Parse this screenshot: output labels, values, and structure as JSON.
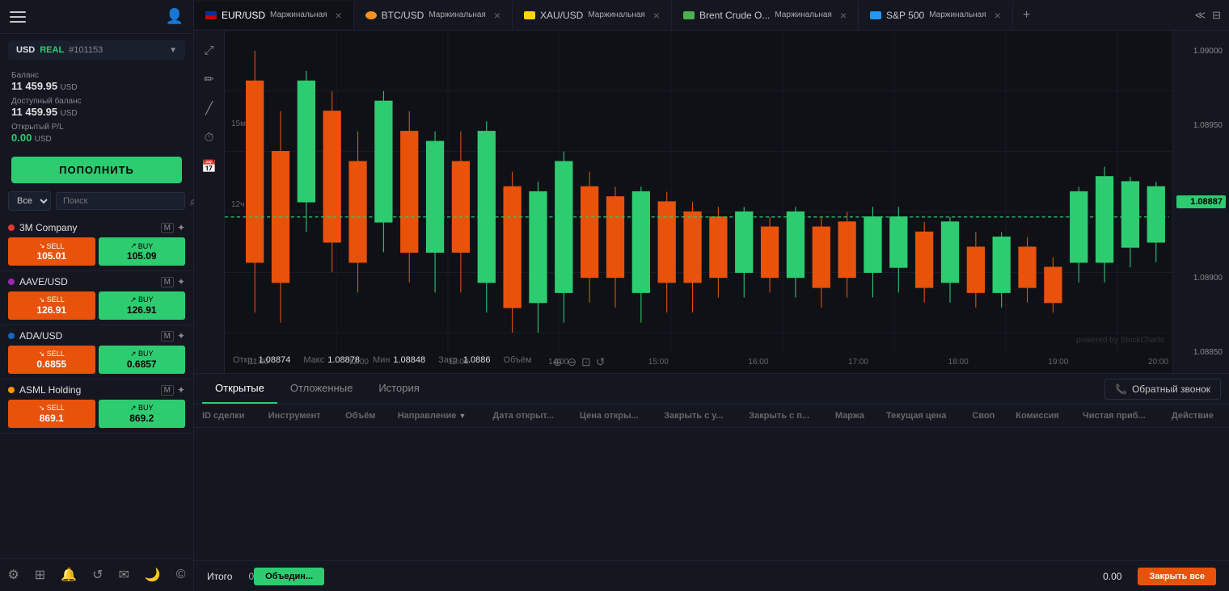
{
  "sidebar": {
    "account": {
      "currency": "USD",
      "type": "REAL",
      "id": "#101153"
    },
    "balance_label": "Баланс",
    "balance_amount": "11 459.95",
    "balance_currency": "USD",
    "available_label": "Доступный баланс",
    "available_amount": "11 459.95",
    "available_currency": "USD",
    "pnl_label": "Открытый Р/L",
    "pnl_amount": "0.00",
    "pnl_currency": "USD",
    "deposit_btn": "ПОПОЛНИТЬ",
    "filter_default": "Все",
    "search_placeholder": "Поиск",
    "instruments": [
      {
        "name": "3M Company",
        "dot_color": "#e53935",
        "sell_label": "SELL",
        "sell_arrow": "↘",
        "sell_price": "105.01",
        "buy_label": "BUY",
        "buy_arrow": "↗",
        "buy_price": "105.09",
        "badge": "M"
      },
      {
        "name": "AAVE/USD",
        "dot_color": "#9c27b0",
        "sell_label": "SELL",
        "sell_arrow": "↘",
        "sell_price": "126.91",
        "buy_label": "BUY",
        "buy_arrow": "↗",
        "buy_price": "126.91",
        "badge": "M"
      },
      {
        "name": "ADA/USD",
        "dot_color": "#1565c0",
        "sell_label": "SELL",
        "sell_arrow": "↘",
        "sell_price": "0.6855",
        "buy_label": "BUY",
        "buy_arrow": "↗",
        "buy_price": "0.6857",
        "badge": "M"
      },
      {
        "name": "ASML Holding",
        "dot_color": "#ff9800",
        "sell_label": "SELL",
        "sell_arrow": "↘",
        "sell_price": "869.1",
        "buy_label": "BUY",
        "buy_arrow": "↗",
        "buy_price": "869.2",
        "badge": "M"
      }
    ],
    "footer_icons": [
      "⚙",
      "⊞",
      "🔔",
      "↺",
      "✉",
      "🌙",
      "©"
    ]
  },
  "tabs": [
    {
      "id": "eurusd",
      "label": "EUR/USD",
      "sublabel": "Маржинальная",
      "active": true,
      "flag_color": "#003399"
    },
    {
      "id": "btcusd",
      "label": "BTC/USD",
      "sublabel": "Маржинальная",
      "active": false,
      "flag_color": "#f7931a"
    },
    {
      "id": "xauusd",
      "label": "XAU/USD",
      "sublabel": "Маржинальная",
      "active": false,
      "flag_color": "#ffd700"
    },
    {
      "id": "brent",
      "label": "Brent Crude O...",
      "sublabel": "Маржинальная",
      "active": false,
      "flag_color": "#4caf50"
    },
    {
      "id": "sp500",
      "label": "S&P 500",
      "sublabel": "Маржинальная",
      "active": false,
      "flag_color": "#2196f3"
    }
  ],
  "chart": {
    "current_price": "1.08887",
    "price_levels": [
      "1.09000",
      "1.08950",
      "1.08900",
      "1.08850"
    ],
    "time_labels": [
      "12:00",
      "13:00",
      "14:00",
      "15:00",
      "16:00",
      "17:00",
      "18:00",
      "19:00",
      "20:00"
    ],
    "interval_15m": "15м",
    "interval_12h": "12ч",
    "ohlcv": {
      "open_label": "Откр.",
      "open_val": "1.08874",
      "high_label": "Макс",
      "high_val": "1.08878",
      "low_label": "Мин",
      "low_val": "1.08848",
      "close_label": "Закр.",
      "close_val": "1.0886",
      "vol_label": "Объём"
    },
    "powered_by": "powered by StockCharts"
  },
  "bottom_panel": {
    "tabs": [
      "Открытые",
      "Отложенные",
      "История"
    ],
    "active_tab": "Открытые",
    "callback_btn": "Обратный звонок",
    "columns": [
      "ID сделки",
      "Инструмент",
      "Объём",
      "Направление",
      "Дата открыт...",
      "Цена откры...",
      "Закрыть с у...",
      "Закрыть с п...",
      "Маржа",
      "Текущая цена",
      "Своп",
      "Комиссия",
      "Чистая приб...",
      "Действие"
    ],
    "footer": {
      "total_label": "Итого",
      "total_val": "0",
      "merge_btn": "Объедин...",
      "pnl_val": "0.00",
      "close_all_btn": "Закрыть все"
    }
  }
}
